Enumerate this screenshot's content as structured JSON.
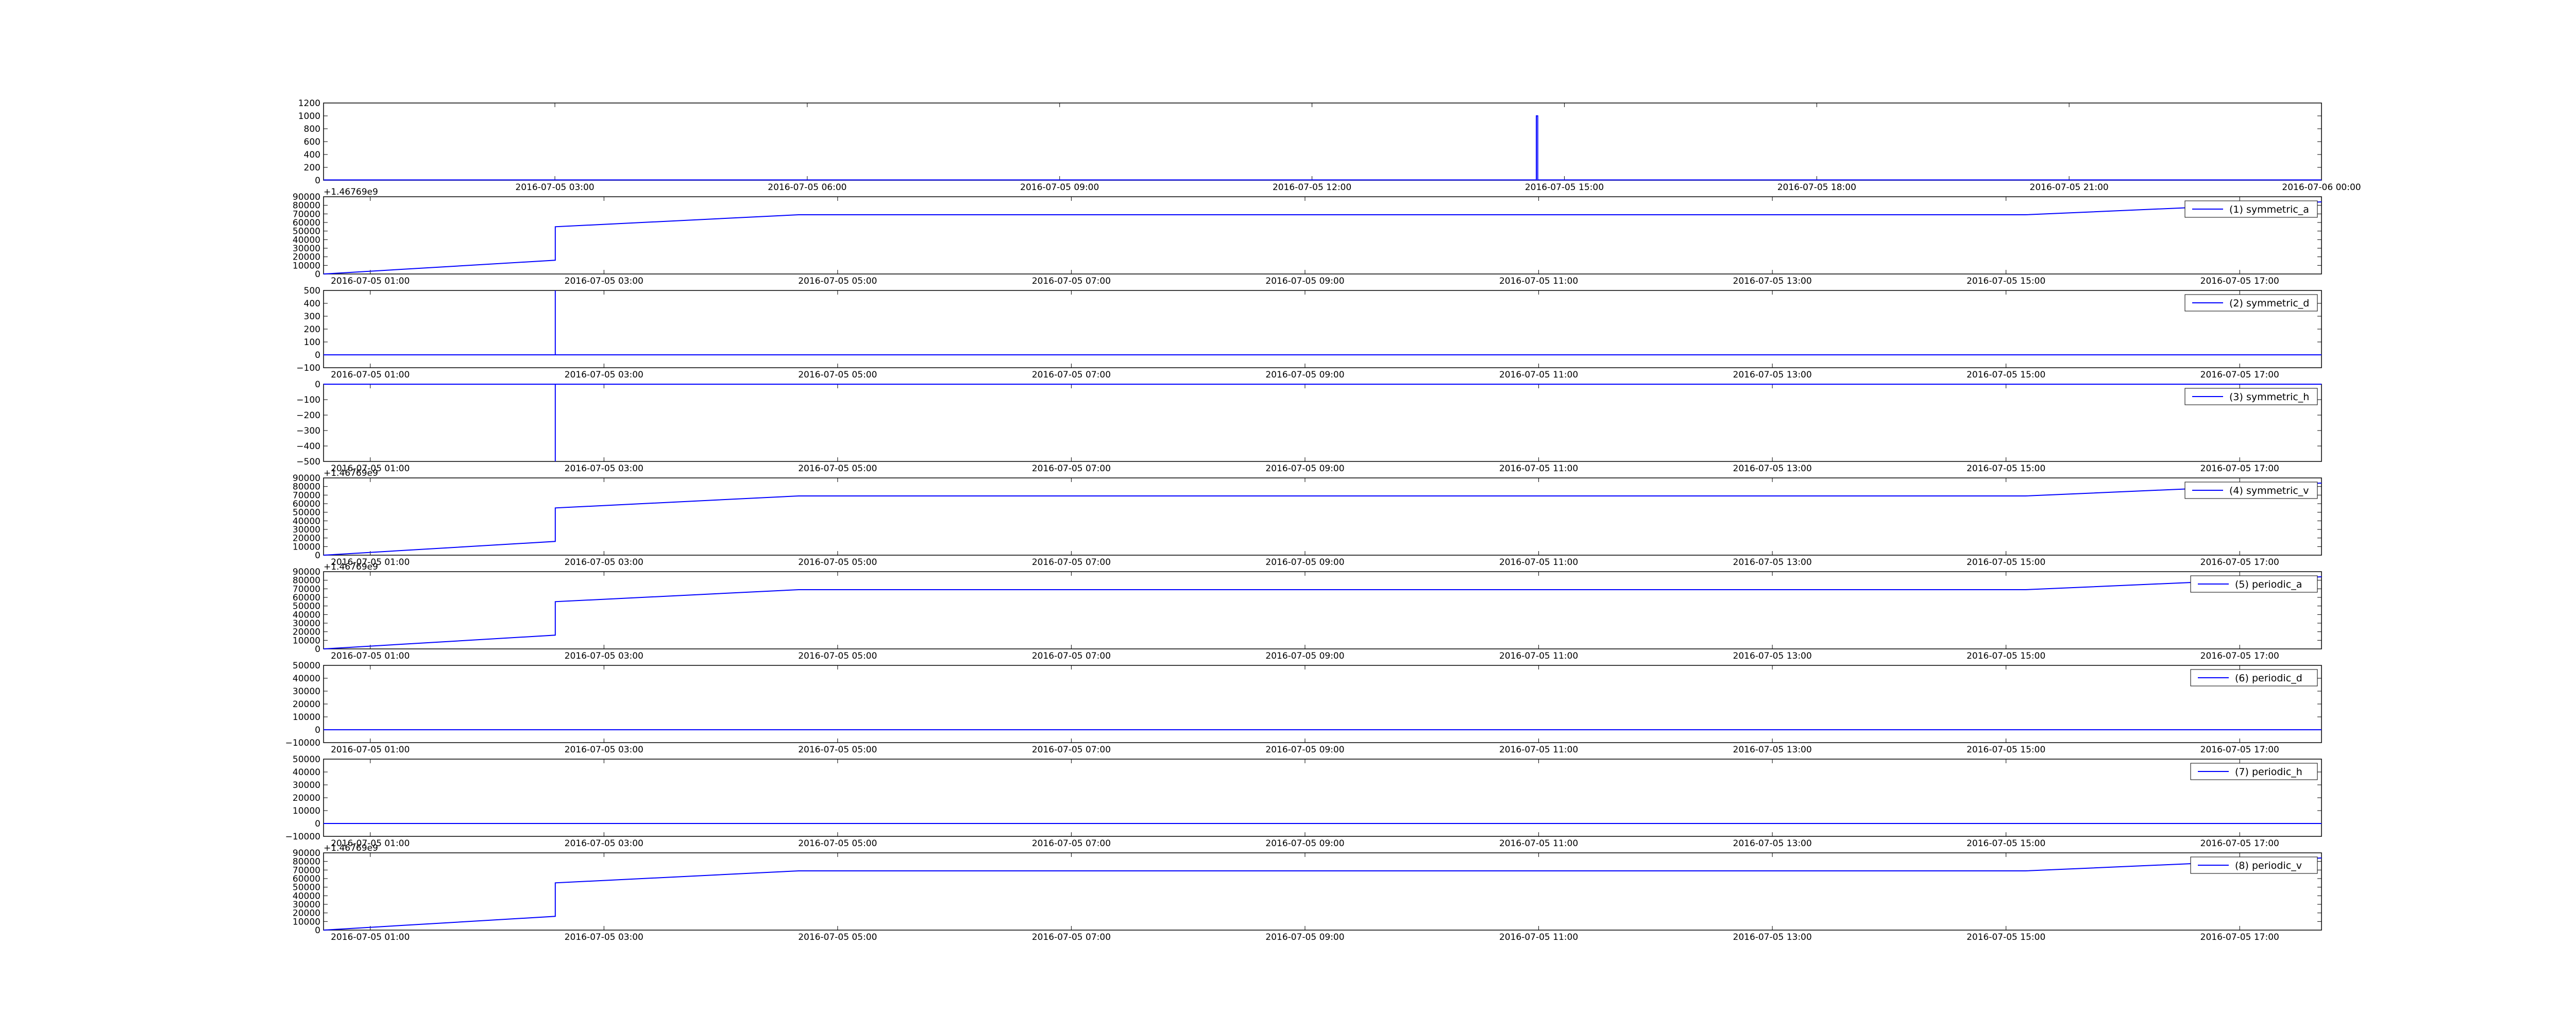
{
  "figure": {
    "background": "#ffffff",
    "line_color": "#0000ff"
  },
  "chart_data": [
    {
      "type": "line",
      "legend": "",
      "offset_label": "",
      "x_ticks": [
        "2016-07-05 03:00",
        "2016-07-05 06:00",
        "2016-07-05 09:00",
        "2016-07-05 12:00",
        "2016-07-05 15:00",
        "2016-07-05 18:00",
        "2016-07-05 21:00",
        "2016-07-06 00:00"
      ],
      "xlim": [
        "2016-07-05 00:15",
        "2016-07-06 00:00"
      ],
      "ylim": [
        0,
        1200
      ],
      "y_ticks": [
        "0",
        "200",
        "400",
        "600",
        "800",
        "1000",
        "1200"
      ],
      "series": [
        {
          "x": [
            "2016-07-05 00:15",
            "2016-07-05 14:40",
            "2016-07-05 14:40",
            "2016-07-05 14:41",
            "2016-07-05 14:41",
            "2016-07-06 00:00"
          ],
          "y": [
            5,
            5,
            1000,
            1000,
            5,
            5
          ]
        }
      ]
    },
    {
      "type": "line",
      "legend": "(1) symmetric_a",
      "offset_label": "+1.46769e9",
      "x_ticks": [
        "2016-07-05 01:00",
        "2016-07-05 03:00",
        "2016-07-05 05:00",
        "2016-07-05 07:00",
        "2016-07-05 09:00",
        "2016-07-05 11:00",
        "2016-07-05 13:00",
        "2016-07-05 15:00",
        "2016-07-05 17:00"
      ],
      "xlim": [
        "2016-07-05 00:36",
        "2016-07-05 17:42"
      ],
      "ylim": [
        0,
        90000
      ],
      "y_ticks": [
        "0",
        "10000",
        "20000",
        "30000",
        "40000",
        "50000",
        "60000",
        "70000",
        "80000",
        "90000"
      ],
      "series": [
        {
          "x": [
            "2016-07-05 00:36",
            "2016-07-05 02:35",
            "2016-07-05 02:35",
            "2016-07-05 04:40",
            "2016-07-05 15:10",
            "2016-07-05 17:42"
          ],
          "y": [
            0,
            16000,
            55000,
            69000,
            69000,
            84000
          ]
        }
      ]
    },
    {
      "type": "line",
      "legend": "(2) symmetric_d",
      "offset_label": "",
      "x_ticks": [
        "2016-07-05 01:00",
        "2016-07-05 03:00",
        "2016-07-05 05:00",
        "2016-07-05 07:00",
        "2016-07-05 09:00",
        "2016-07-05 11:00",
        "2016-07-05 13:00",
        "2016-07-05 15:00",
        "2016-07-05 17:00"
      ],
      "xlim": [
        "2016-07-05 00:36",
        "2016-07-05 17:42"
      ],
      "ylim": [
        -100,
        500
      ],
      "y_ticks": [
        "−100",
        "0",
        "100",
        "200",
        "300",
        "400",
        "500"
      ],
      "series": [
        {
          "x": [
            "2016-07-05 00:36",
            "2016-07-05 02:35",
            "2016-07-05 02:35",
            "2016-07-05 02:35",
            "2016-07-05 17:42"
          ],
          "y": [
            0,
            0,
            500,
            0,
            0
          ]
        }
      ]
    },
    {
      "type": "line",
      "legend": "(3) symmetric_h",
      "offset_label": "",
      "x_ticks": [
        "2016-07-05 01:00",
        "2016-07-05 03:00",
        "2016-07-05 05:00",
        "2016-07-05 07:00",
        "2016-07-05 09:00",
        "2016-07-05 11:00",
        "2016-07-05 13:00",
        "2016-07-05 15:00",
        "2016-07-05 17:00"
      ],
      "xlim": [
        "2016-07-05 00:36",
        "2016-07-05 17:42"
      ],
      "ylim": [
        -500,
        0
      ],
      "y_ticks": [
        "−500",
        "−400",
        "−300",
        "−200",
        "−100",
        "0"
      ],
      "series": [
        {
          "x": [
            "2016-07-05 00:36",
            "2016-07-05 02:35",
            "2016-07-05 02:35",
            "2016-07-05 02:35",
            "2016-07-05 17:42"
          ],
          "y": [
            0,
            0,
            -500,
            0,
            0
          ]
        }
      ]
    },
    {
      "type": "line",
      "legend": "(4) symmetric_v",
      "offset_label": "+1.46769e9",
      "x_ticks": [
        "2016-07-05 01:00",
        "2016-07-05 03:00",
        "2016-07-05 05:00",
        "2016-07-05 07:00",
        "2016-07-05 09:00",
        "2016-07-05 11:00",
        "2016-07-05 13:00",
        "2016-07-05 15:00",
        "2016-07-05 17:00"
      ],
      "xlim": [
        "2016-07-05 00:36",
        "2016-07-05 17:42"
      ],
      "ylim": [
        0,
        90000
      ],
      "y_ticks": [
        "0",
        "10000",
        "20000",
        "30000",
        "40000",
        "50000",
        "60000",
        "70000",
        "80000",
        "90000"
      ],
      "series": [
        {
          "x": [
            "2016-07-05 00:36",
            "2016-07-05 02:35",
            "2016-07-05 02:35",
            "2016-07-05 04:40",
            "2016-07-05 15:10",
            "2016-07-05 17:42"
          ],
          "y": [
            0,
            16000,
            55000,
            69000,
            69000,
            84000
          ]
        }
      ]
    },
    {
      "type": "line",
      "legend": "(5) periodic_a",
      "offset_label": "+1.46769e9",
      "x_ticks": [
        "2016-07-05 01:00",
        "2016-07-05 03:00",
        "2016-07-05 05:00",
        "2016-07-05 07:00",
        "2016-07-05 09:00",
        "2016-07-05 11:00",
        "2016-07-05 13:00",
        "2016-07-05 15:00",
        "2016-07-05 17:00"
      ],
      "xlim": [
        "2016-07-05 00:36",
        "2016-07-05 17:42"
      ],
      "ylim": [
        0,
        90000
      ],
      "y_ticks": [
        "0",
        "10000",
        "20000",
        "30000",
        "40000",
        "50000",
        "60000",
        "70000",
        "80000",
        "90000"
      ],
      "series": [
        {
          "x": [
            "2016-07-05 00:36",
            "2016-07-05 02:35",
            "2016-07-05 02:35",
            "2016-07-05 04:40",
            "2016-07-05 15:10",
            "2016-07-05 17:42"
          ],
          "y": [
            0,
            16000,
            55000,
            69000,
            69000,
            84000
          ]
        }
      ]
    },
    {
      "type": "line",
      "legend": "(6) periodic_d",
      "offset_label": "",
      "x_ticks": [
        "2016-07-05 01:00",
        "2016-07-05 03:00",
        "2016-07-05 05:00",
        "2016-07-05 07:00",
        "2016-07-05 09:00",
        "2016-07-05 11:00",
        "2016-07-05 13:00",
        "2016-07-05 15:00",
        "2016-07-05 17:00"
      ],
      "xlim": [
        "2016-07-05 00:36",
        "2016-07-05 17:42"
      ],
      "ylim": [
        -10000,
        50000
      ],
      "y_ticks": [
        "−10000",
        "0",
        "10000",
        "20000",
        "30000",
        "40000",
        "50000"
      ],
      "series": [
        {
          "x": [
            "2016-07-05 00:36",
            "2016-07-05 17:42"
          ],
          "y": [
            0,
            0
          ]
        }
      ]
    },
    {
      "type": "line",
      "legend": "(7) periodic_h",
      "offset_label": "",
      "x_ticks": [
        "2016-07-05 01:00",
        "2016-07-05 03:00",
        "2016-07-05 05:00",
        "2016-07-05 07:00",
        "2016-07-05 09:00",
        "2016-07-05 11:00",
        "2016-07-05 13:00",
        "2016-07-05 15:00",
        "2016-07-05 17:00"
      ],
      "xlim": [
        "2016-07-05 00:36",
        "2016-07-05 17:42"
      ],
      "ylim": [
        -10000,
        50000
      ],
      "y_ticks": [
        "−10000",
        "0",
        "10000",
        "20000",
        "30000",
        "40000",
        "50000"
      ],
      "series": [
        {
          "x": [
            "2016-07-05 00:36",
            "2016-07-05 17:42"
          ],
          "y": [
            0,
            0
          ]
        }
      ]
    },
    {
      "type": "line",
      "legend": "(8) periodic_v",
      "offset_label": "+1.46769e9",
      "x_ticks": [
        "2016-07-05 01:00",
        "2016-07-05 03:00",
        "2016-07-05 05:00",
        "2016-07-05 07:00",
        "2016-07-05 09:00",
        "2016-07-05 11:00",
        "2016-07-05 13:00",
        "2016-07-05 15:00",
        "2016-07-05 17:00"
      ],
      "xlim": [
        "2016-07-05 00:36",
        "2016-07-05 17:42"
      ],
      "ylim": [
        0,
        90000
      ],
      "y_ticks": [
        "0",
        "10000",
        "20000",
        "30000",
        "40000",
        "50000",
        "60000",
        "70000",
        "80000",
        "90000"
      ],
      "series": [
        {
          "x": [
            "2016-07-05 00:36",
            "2016-07-05 02:35",
            "2016-07-05 02:35",
            "2016-07-05 04:40",
            "2016-07-05 15:10",
            "2016-07-05 17:42"
          ],
          "y": [
            0,
            16000,
            55000,
            69000,
            69000,
            84000
          ]
        }
      ]
    }
  ]
}
